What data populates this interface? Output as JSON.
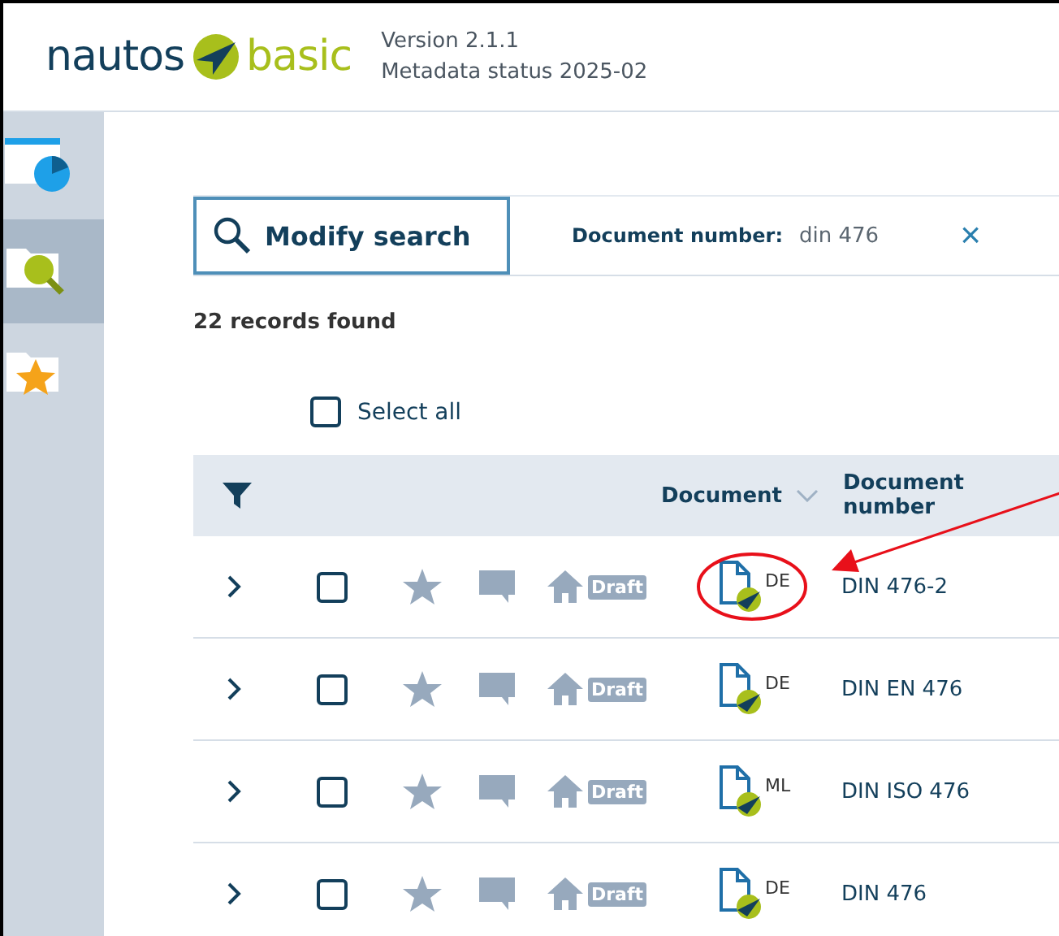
{
  "header": {
    "logo_left": "nautos",
    "logo_right": "basic",
    "version": "Version 2.1.1",
    "metadata_status": "Metadata status 2025-02"
  },
  "sidebar": {
    "items": [
      {
        "kind": "dashboard",
        "selected": false
      },
      {
        "kind": "search",
        "selected": true
      },
      {
        "kind": "favorites",
        "selected": false
      }
    ]
  },
  "search": {
    "button": "Modify search",
    "filter_label": "Document number:",
    "filter_value": "din 476",
    "clear": "×"
  },
  "result_count": "22 records found",
  "select_all": {
    "label": "Select all",
    "checked": false
  },
  "table": {
    "columns": [
      {
        "label": "Document",
        "sortable": true
      },
      {
        "label": "Document number",
        "sortable": false
      }
    ],
    "rows": [
      {
        "checked": false,
        "badge": "Draft",
        "language": "DE",
        "number": "DIN 476-2",
        "highlighted": true
      },
      {
        "checked": false,
        "badge": "Draft",
        "language": "DE",
        "number": "DIN EN 476",
        "highlighted": false
      },
      {
        "checked": false,
        "badge": "Draft",
        "language": "ML",
        "number": "DIN ISO 476",
        "highlighted": false
      },
      {
        "checked": false,
        "badge": "Draft",
        "language": "DE",
        "number": "DIN 476",
        "highlighted": false
      }
    ]
  }
}
